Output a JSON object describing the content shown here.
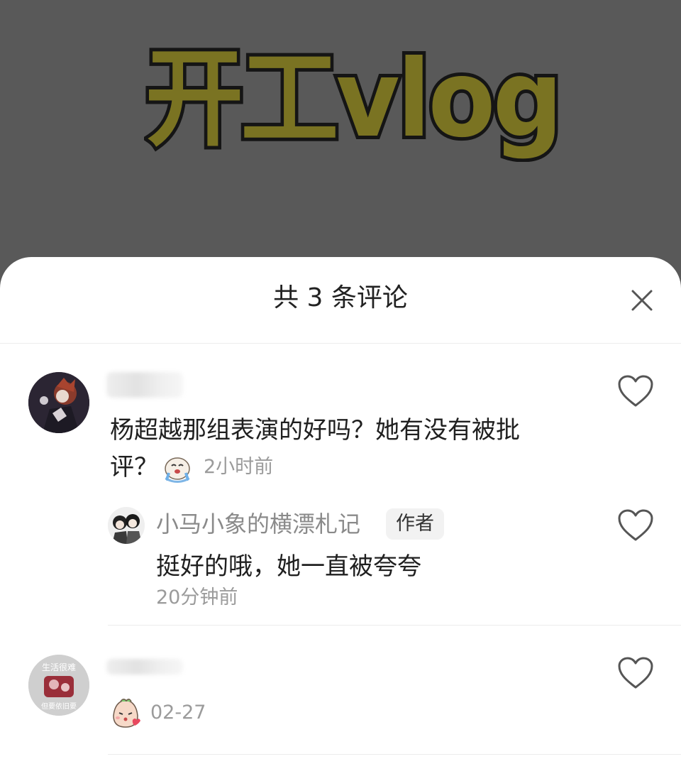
{
  "video": {
    "title": "开工vlog"
  },
  "sheet": {
    "title": "共 3 条评论"
  },
  "comments": [
    {
      "text": "杨超越那组表演的好吗？她有没有被批评？",
      "text_line1": "杨超越那组表演的好吗？她有没有被批",
      "text_line2": "评？",
      "emoji": "crying-emoji",
      "time": "2小时前",
      "reply": {
        "username": "小马小象的横漂札记",
        "badge": "作者",
        "text": "挺好的哦，她一直被夸夸",
        "time": "20分钟前"
      }
    },
    {
      "text": "",
      "emoji": "blowing-kiss-emoji",
      "time": "02-27",
      "avatar_text_top": "生活很难",
      "avatar_text_bottom": "但要依旧要"
    }
  ],
  "colors": {
    "video_bg": "#595959",
    "title_fill": "#7a7322",
    "sheet_bg": "#ffffff",
    "text_primary": "#1f1f1f",
    "text_secondary": "#9b9b9b"
  }
}
